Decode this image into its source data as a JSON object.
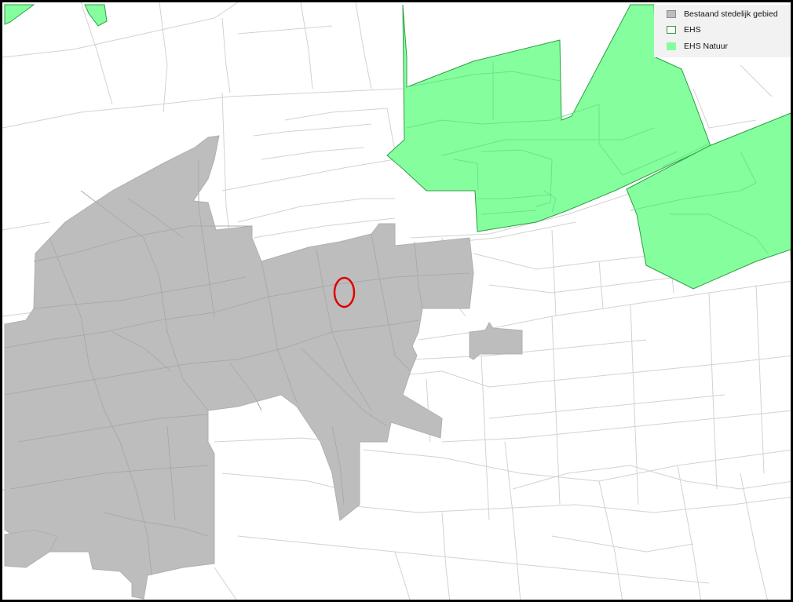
{
  "legend": {
    "items": [
      {
        "label": "Bestaand stedelijk gebied",
        "swatch": "#bdbdbd",
        "border": "#8c8c8c",
        "style": "fill"
      },
      {
        "label": "EHS",
        "swatch": "#ffffff",
        "border": "#2e9e45",
        "style": "outline"
      },
      {
        "label": "EHS Natuur",
        "swatch": "#85ff9e",
        "border": "#85ff9e",
        "style": "fill"
      }
    ]
  },
  "colors": {
    "urban": "#bdbdbd",
    "ehs_natuur": "#85ff9e",
    "ehs_outline": "#2e9e45",
    "streets": "#d2d2d2",
    "frame": "#000000",
    "marker": "#e00000"
  },
  "map": {
    "marker_shape": "ellipse"
  }
}
